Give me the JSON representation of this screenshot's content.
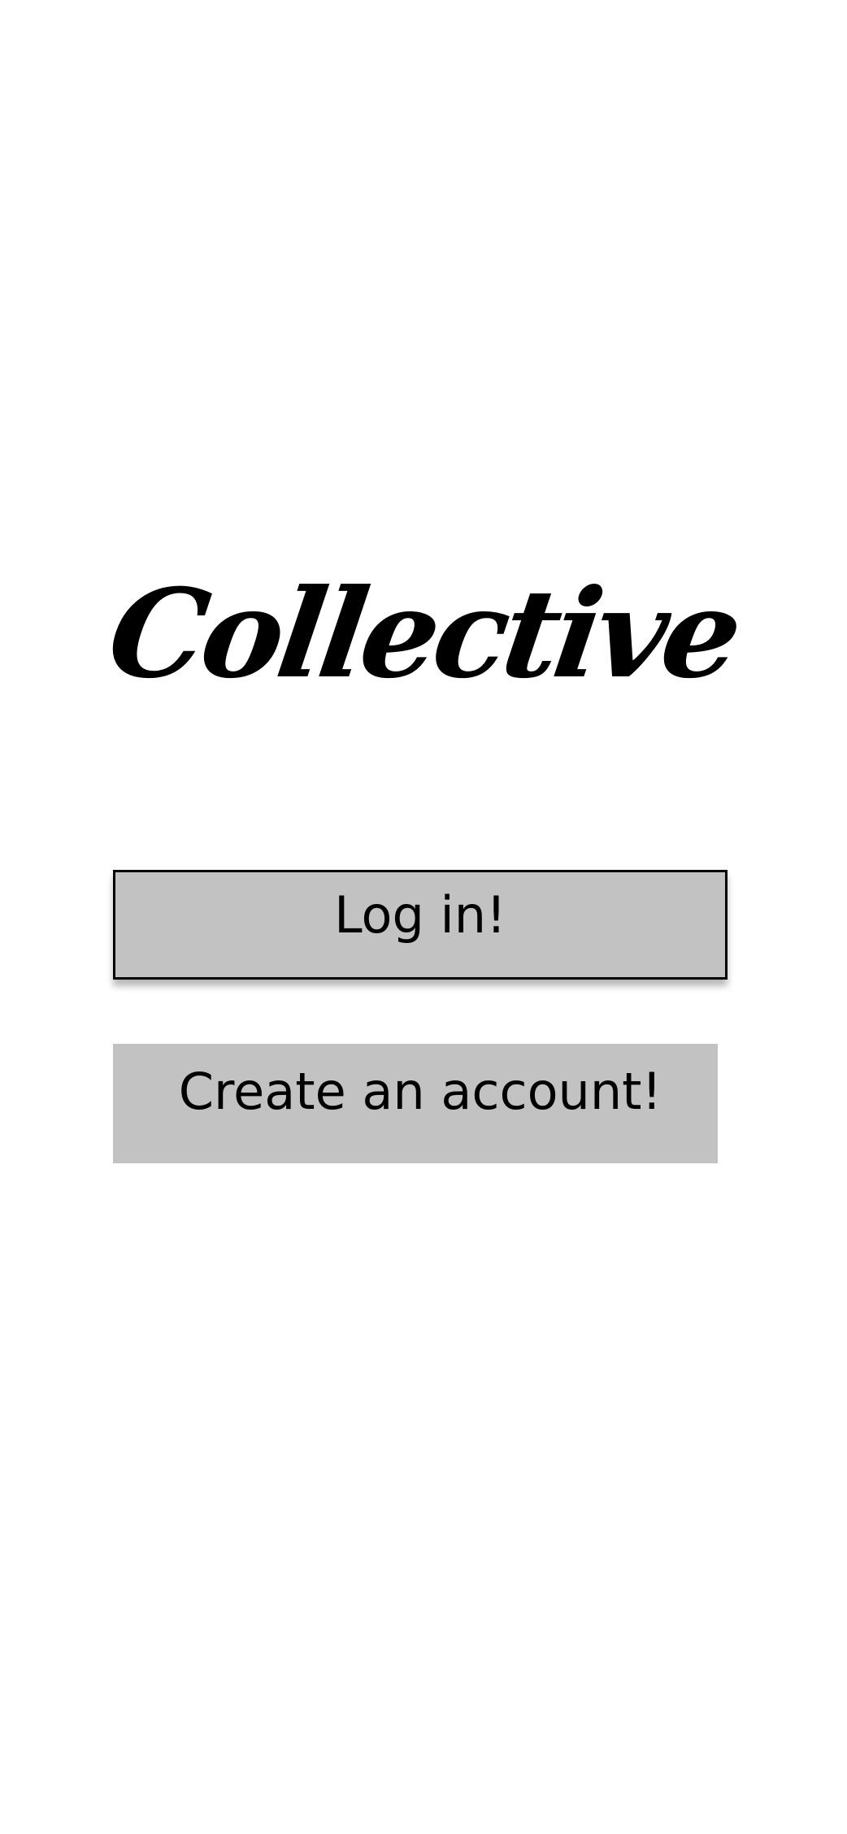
{
  "app": {
    "logo_text": "Collective"
  },
  "actions": {
    "login_label": "Log in!",
    "create_account_label": "Create an account!"
  },
  "colors": {
    "background": "#ffffff",
    "button_fill": "#c2c2c2",
    "button_text": "#000000",
    "logo_color": "#000000"
  }
}
